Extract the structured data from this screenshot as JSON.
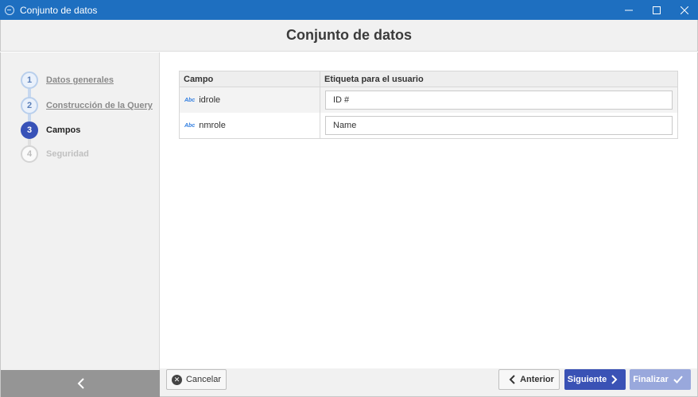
{
  "window": {
    "title": "Conjunto de datos",
    "minimize_icon": "minimize-icon",
    "maximize_icon": "maximize-icon",
    "close_icon": "close-icon"
  },
  "header": {
    "title": "Conjunto de datos"
  },
  "sidebar": {
    "steps": [
      {
        "number": "1",
        "label": "Datos generales",
        "state": "completed"
      },
      {
        "number": "2",
        "label": "Construcción de la Query",
        "state": "completed"
      },
      {
        "number": "3",
        "label": "Campos",
        "state": "active"
      },
      {
        "number": "4",
        "label": "Seguridad",
        "state": "disabled"
      }
    ],
    "collapse_icon": "chevron-left-icon"
  },
  "grid": {
    "columns": [
      "Campo",
      "Etiqueta para el usuario"
    ],
    "rows": [
      {
        "type_icon": "Abc",
        "field": "idrole",
        "label_value": "ID #"
      },
      {
        "type_icon": "Abc",
        "field": "nmrole",
        "label_value": "Name"
      }
    ]
  },
  "footer": {
    "cancel_label": "Cancelar",
    "prev_label": "Anterior",
    "next_label": "Siguiente",
    "finish_label": "Finalizar"
  },
  "colors": {
    "titlebar": "#1e6fc0",
    "accent": "#3a52b5",
    "disabled_accent": "#99a8dc"
  }
}
